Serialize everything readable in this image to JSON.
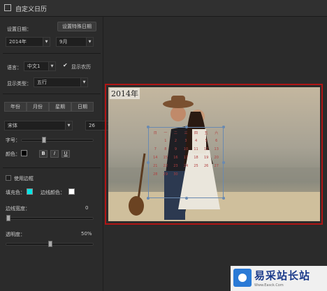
{
  "window": {
    "title": "自定义日历"
  },
  "panel": {
    "set_date_label": "设置日期：",
    "special_date_button": "设置特殊日期",
    "year_value": "2014年",
    "month_value": "9月",
    "language_label": "语言：",
    "language_value": "中文1",
    "lunar_checkbox_label": "显示农历",
    "lunar_checked": true,
    "display_type_label": "显示类型：",
    "display_type_value": "五行",
    "tabs": [
      "年份",
      "月份",
      "星期",
      "日期"
    ],
    "font_value": "宋体",
    "font_size_value": "26",
    "size_label": "字号：",
    "color_label": "颜色：",
    "text_color": "#000000",
    "bold_label": "B",
    "italic_label": "I",
    "underline_label": "U",
    "use_border_label": "使用边框",
    "fill_color_label": "填充色：",
    "fill_color": "#00e5e5",
    "border_color_label": "边线颜色：",
    "border_color": "#ffffff",
    "border_width_label": "边线宽度：",
    "border_width_value": "0",
    "opacity_label": "透明度：",
    "opacity_value": "50%",
    "size_slider_level": 0.3,
    "opacity_slider_level": 0.5
  },
  "preview": {
    "year_label": "2014年",
    "frame_color": "#b01515",
    "calendar_cells": [
      "日",
      "一",
      "二",
      "三",
      "四",
      "五",
      "六",
      "",
      "1",
      "2",
      "3",
      "4",
      "5",
      "6",
      "7",
      "8",
      "9",
      "10",
      "11",
      "12",
      "13",
      "14",
      "15",
      "16",
      "17",
      "18",
      "19",
      "20",
      "21",
      "22",
      "23",
      "24",
      "25",
      "26",
      "27",
      "28",
      "29",
      "30"
    ]
  },
  "watermark": {
    "brand": "易采站长站",
    "sub": "Www.Easck.Com"
  }
}
